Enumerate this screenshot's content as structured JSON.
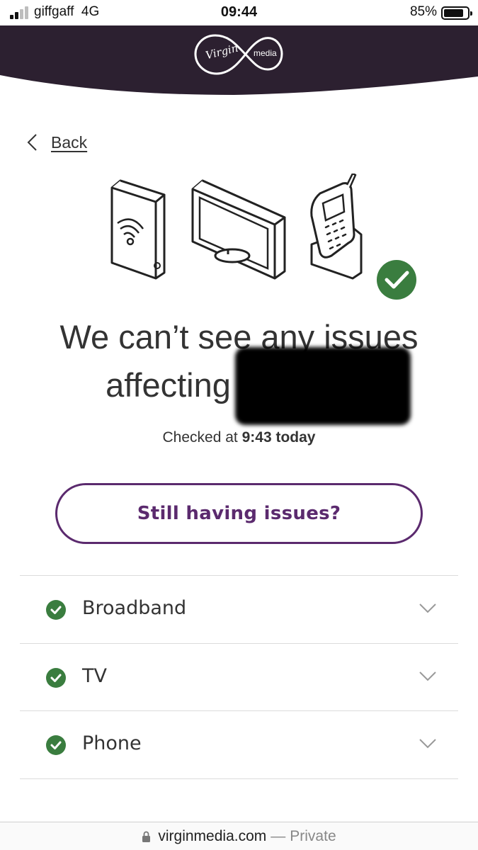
{
  "status_bar": {
    "carrier": "giffgaff",
    "network": "4G",
    "time": "09:44",
    "battery": "85%",
    "battery_level": 0.85
  },
  "header": {
    "logo_text_left": "Virgin",
    "logo_text_right": "media",
    "bg_color": "#2c2030"
  },
  "nav": {
    "back_label": "Back"
  },
  "status": {
    "heading_line1": "We can’t see any issues",
    "heading_line2": "affecting",
    "checked_prefix": "Checked at",
    "checked_time": "9:43 today"
  },
  "cta": {
    "label": "Still having issues?"
  },
  "services": [
    {
      "name": "Broadband",
      "status": "ok"
    },
    {
      "name": "TV",
      "status": "ok"
    },
    {
      "name": "Phone",
      "status": "ok"
    }
  ],
  "url_bar": {
    "domain": "virginmedia.com",
    "separator": "—",
    "mode": "Private"
  },
  "colors": {
    "accent": "#5b2a6e",
    "success": "#3a7d3f",
    "text": "#333333"
  }
}
